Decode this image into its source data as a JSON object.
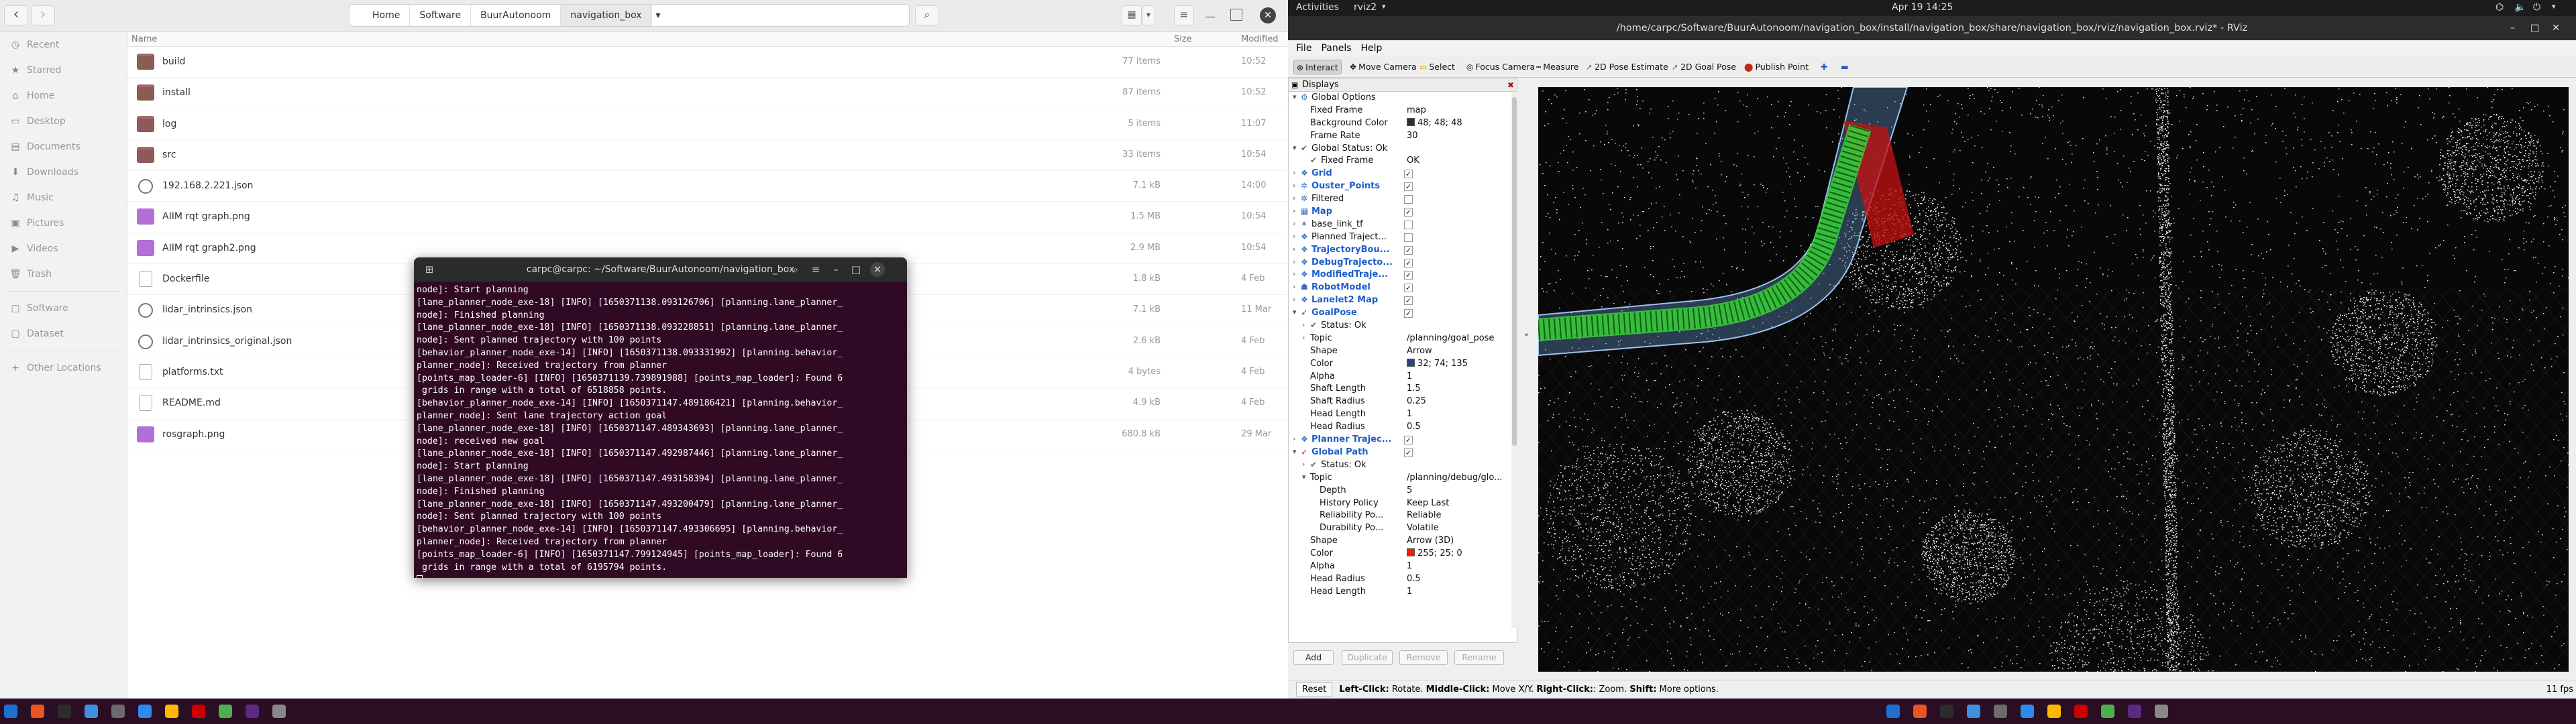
{
  "files": {
    "nav": {
      "back": "‹",
      "forward": "›"
    },
    "breadcrumbs": [
      "Home",
      "Software",
      "BuurAutonoom",
      "navigation_box"
    ],
    "columns": {
      "name": "Name",
      "size": "Size",
      "modified": "Modified"
    },
    "sidebar": [
      {
        "icon": "◷",
        "label": "Recent"
      },
      {
        "icon": "★",
        "label": "Starred"
      },
      {
        "icon": "⌂",
        "label": "Home"
      },
      {
        "icon": "▭",
        "label": "Desktop"
      },
      {
        "icon": "▤",
        "label": "Documents"
      },
      {
        "icon": "⬇",
        "label": "Downloads"
      },
      {
        "icon": "♫",
        "label": "Music"
      },
      {
        "icon": "▣",
        "label": "Pictures"
      },
      {
        "icon": "▶",
        "label": "Videos"
      },
      {
        "icon": "🗑",
        "label": "Trash"
      },
      {
        "icon": "▢",
        "label": "Software"
      },
      {
        "icon": "▢",
        "label": "Dataset"
      },
      {
        "icon": "+",
        "label": "Other Locations"
      }
    ],
    "rows": [
      {
        "type": "folder",
        "name": "build",
        "size": "77 items",
        "date": "10:52"
      },
      {
        "type": "folder",
        "name": "install",
        "size": "87 items",
        "date": "10:52"
      },
      {
        "type": "folder",
        "name": "log",
        "size": "5 items",
        "date": "11:07"
      },
      {
        "type": "folder",
        "name": "src",
        "size": "33 items",
        "date": "10:54"
      },
      {
        "type": "json",
        "name": "192.168.2.221.json",
        "size": "7.1 kB",
        "date": "14:00"
      },
      {
        "type": "img",
        "name": "AIIM rqt graph.png",
        "size": "1.5 MB",
        "date": "10:54"
      },
      {
        "type": "img",
        "name": "AIIM rqt graph2.png",
        "size": "2.9 MB",
        "date": "10:54"
      },
      {
        "type": "txt",
        "name": "Dockerfile",
        "size": "1.8 kB",
        "date": "4 Feb"
      },
      {
        "type": "json",
        "name": "lidar_intrinsics.json",
        "size": "7.1 kB",
        "date": "11 Mar"
      },
      {
        "type": "json",
        "name": "lidar_intrinsics_original.json",
        "size": "2.6 kB",
        "date": "4 Feb"
      },
      {
        "type": "txt",
        "name": "platforms.txt",
        "size": "4 bytes",
        "date": "4 Feb"
      },
      {
        "type": "txt",
        "name": "README.md",
        "size": "4.9 kB",
        "date": "4 Feb"
      },
      {
        "type": "img",
        "name": "rosgraph.png",
        "size": "680.8 kB",
        "date": "29 Mar"
      }
    ]
  },
  "terminal": {
    "title": "carpc@carpc: ~/Software/BuurAutonoom/navigation_box",
    "lines": [
      "node]: Start planning",
      "[lane_planner_node_exe-18] [INFO] [1650371138.093126706] [planning.lane_planner_",
      "node]: Finished planning",
      "[lane_planner_node_exe-18] [INFO] [1650371138.093228851] [planning.lane_planner_",
      "node]: Sent planned trajectory with 100 points",
      "[behavior_planner_node_exe-14] [INFO] [1650371138.093331992] [planning.behavior_",
      "planner_node]: Received trajectory from planner",
      "[points_map_loader-6] [INFO] [1650371139.739891988] [points_map_loader]: Found 6",
      " grids in range with a total of 6518858 points.",
      "[behavior_planner_node_exe-14] [INFO] [1650371147.489186421] [planning.behavior_",
      "planner_node]: Sent lane trajectory action goal",
      "[lane_planner_node_exe-18] [INFO] [1650371147.489343693] [planning.lane_planner_",
      "node]: received new goal",
      "[lane_planner_node_exe-18] [INFO] [1650371147.492987446] [planning.lane_planner_",
      "node]: Start planning",
      "[lane_planner_node_exe-18] [INFO] [1650371147.493158394] [planning.lane_planner_",
      "node]: Finished planning",
      "[lane_planner_node_exe-18] [INFO] [1650371147.493200479] [planning.lane_planner_",
      "node]: Sent planned trajectory with 100 points",
      "[behavior_planner_node_exe-14] [INFO] [1650371147.493306695] [planning.behavior_",
      "planner_node]: Received trajectory from planner",
      "[points_map_loader-6] [INFO] [1650371147.799124945] [points_map_loader]: Found 6",
      " grids in range with a total of 6195794 points."
    ]
  },
  "topbar": {
    "activities": "Activities",
    "app": "rviz2",
    "clock": "Apr 19  14:25"
  },
  "rviz": {
    "title": "/home/carpc/Software/BuurAutonoom/navigation_box/install/navigation_box/share/navigation_box/rviz/navigation_box.rviz* - RViz",
    "menu": [
      "File",
      "Panels",
      "Help"
    ],
    "tools": [
      "Interact",
      "Move Camera",
      "Select",
      "Focus Camera",
      "Measure",
      "2D Pose Estimate",
      "2D Goal Pose",
      "Publish Point"
    ],
    "displays_title": "Displays",
    "tree": [
      {
        "ind": 0,
        "ex": "▾",
        "ic": "⚙",
        "name": "Global Options",
        "val": ""
      },
      {
        "ind": 1,
        "name": "Fixed Frame",
        "val": "map"
      },
      {
        "ind": 1,
        "name": "Background Color",
        "val": "48; 48; 48",
        "sw": "#303030"
      },
      {
        "ind": 1,
        "name": "Frame Rate",
        "val": "30"
      },
      {
        "ind": 0,
        "ex": "▾",
        "ic": "✔",
        "name": "Global Status: Ok",
        "val": ""
      },
      {
        "ind": 1,
        "ic": "✔",
        "name": "Fixed Frame",
        "val": "OK"
      },
      {
        "ind": 0,
        "ex": "›",
        "ic": "❖",
        "name": "Grid",
        "blue": true,
        "ck": true
      },
      {
        "ind": 0,
        "ex": "›",
        "ic": "✲",
        "name": "Ouster_Points",
        "blue": true,
        "ck": true
      },
      {
        "ind": 0,
        "ex": "›",
        "ic": "✲",
        "name": "Filtered",
        "ck": false
      },
      {
        "ind": 0,
        "ex": "›",
        "ic": "▦",
        "name": "Map",
        "blue": true,
        "ck": true
      },
      {
        "ind": 0,
        "ex": "›",
        "ic": "✶",
        "name": "base_link_tf",
        "ck": false
      },
      {
        "ind": 0,
        "ex": "›",
        "ic": "❖",
        "name": "Planned Traject...",
        "ck": false
      },
      {
        "ind": 0,
        "ex": "›",
        "ic": "❖",
        "name": "TrajectoryBou...",
        "blue": true,
        "ck": true
      },
      {
        "ind": 0,
        "ex": "›",
        "ic": "❖",
        "name": "DebugTrajecto...",
        "blue": true,
        "ck": true
      },
      {
        "ind": 0,
        "ex": "›",
        "ic": "❖",
        "name": "ModifiedTraje...",
        "blue": true,
        "ck": true
      },
      {
        "ind": 0,
        "ex": "›",
        "ic": "☗",
        "name": "RobotModel",
        "blue": true,
        "ck": true
      },
      {
        "ind": 0,
        "ex": "›",
        "ic": "❖",
        "name": "Lanelet2 Map",
        "blue": true,
        "ck": true
      },
      {
        "ind": 0,
        "ex": "▾",
        "ic": "➶",
        "name": "GoalPose",
        "blue": true,
        "ck": true
      },
      {
        "ind": 1,
        "ex": "›",
        "ic": "✔",
        "name": "Status: Ok",
        "val": ""
      },
      {
        "ind": 1,
        "ex": "›",
        "name": "Topic",
        "val": "/planning/goal_pose"
      },
      {
        "ind": 1,
        "name": "Shape",
        "val": "Arrow"
      },
      {
        "ind": 1,
        "name": "Color",
        "val": "32; 74; 135",
        "sw": "#204a87"
      },
      {
        "ind": 1,
        "name": "Alpha",
        "val": "1"
      },
      {
        "ind": 1,
        "name": "Shaft Length",
        "val": "1.5"
      },
      {
        "ind": 1,
        "name": "Shaft Radius",
        "val": "0.25"
      },
      {
        "ind": 1,
        "name": "Head Length",
        "val": "1"
      },
      {
        "ind": 1,
        "name": "Head Radius",
        "val": "0.5"
      },
      {
        "ind": 0,
        "ex": "›",
        "ic": "❖",
        "name": "Planner Trajec...",
        "blue": true,
        "ck": true
      },
      {
        "ind": 0,
        "ex": "▾",
        "ic": "➶",
        "name": "Global Path",
        "blue": true,
        "ck": true
      },
      {
        "ind": 1,
        "ex": "›",
        "ic": "✔",
        "name": "Status: Ok",
        "val": ""
      },
      {
        "ind": 1,
        "ex": "▾",
        "name": "Topic",
        "val": "/planning/debug/glo..."
      },
      {
        "ind": 2,
        "name": "Depth",
        "val": "5"
      },
      {
        "ind": 2,
        "name": "History Policy",
        "val": "Keep Last"
      },
      {
        "ind": 2,
        "name": "Reliability Po...",
        "val": "Reliable"
      },
      {
        "ind": 2,
        "name": "Durability Po...",
        "val": "Volatile"
      },
      {
        "ind": 1,
        "name": "Shape",
        "val": "Arrow (3D)"
      },
      {
        "ind": 1,
        "name": "Color",
        "val": "255; 25; 0",
        "sw": "#ff1900"
      },
      {
        "ind": 1,
        "name": "Alpha",
        "val": "1"
      },
      {
        "ind": 1,
        "name": "Head Radius",
        "val": "0.5"
      },
      {
        "ind": 1,
        "name": "Head Length",
        "val": "1"
      }
    ],
    "buttons": [
      "Add",
      "Duplicate",
      "Remove",
      "Rename"
    ],
    "status": {
      "reset": "Reset",
      "hint_l": "Left-Click:",
      "hint_l_t": " Rotate. ",
      "hint_m": "Middle-Click:",
      "hint_m_t": " Move X/Y. ",
      "hint_r": "Right-Click:",
      "hint_r_t": ": Zoom. ",
      "hint_s": "Shift:",
      "hint_s_t": " More options.",
      "fps": "11 fps"
    }
  },
  "colors": {
    "terminal_bg": "#300a24",
    "path_green": "#39d13a",
    "path_red": "#c81010",
    "path_blue": "#6b9ed6"
  }
}
